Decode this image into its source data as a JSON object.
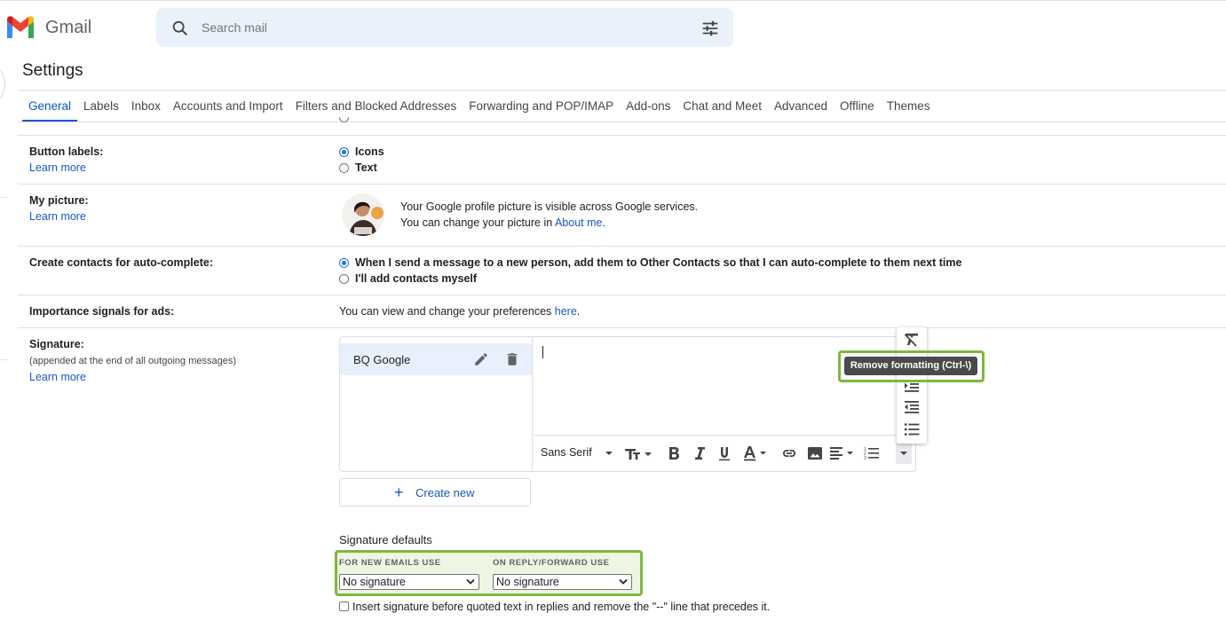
{
  "app": {
    "name": "Gmail"
  },
  "search": {
    "placeholder": "Search mail"
  },
  "settings": {
    "title": "Settings"
  },
  "tabs": [
    {
      "label": "General",
      "active": true
    },
    {
      "label": "Labels"
    },
    {
      "label": "Inbox"
    },
    {
      "label": "Accounts and Import"
    },
    {
      "label": "Filters and Blocked Addresses"
    },
    {
      "label": "Forwarding and POP/IMAP"
    },
    {
      "label": "Add-ons"
    },
    {
      "label": "Chat and Meet"
    },
    {
      "label": "Advanced"
    },
    {
      "label": "Offline"
    },
    {
      "label": "Themes"
    }
  ],
  "button_labels": {
    "label": "Button labels:",
    "learn_more": "Learn more",
    "options": [
      "Icons",
      "Text"
    ],
    "selected": "Icons"
  },
  "my_picture": {
    "label": "My picture:",
    "learn_more": "Learn more",
    "line1": "Your Google profile picture is visible across Google services.",
    "line2_prefix": "You can change your picture in ",
    "line2_link": "About me",
    "line2_suffix": "."
  },
  "contacts": {
    "label": "Create contacts for auto-complete:",
    "options": [
      "When I send a message to a new person, add them to Other Contacts so that I can auto-complete to them next time",
      "I'll add contacts myself"
    ],
    "selected": 0
  },
  "importance": {
    "label": "Importance signals for ads:",
    "text_prefix": "You can view and change your preferences ",
    "link": "here",
    "text_suffix": "."
  },
  "signature": {
    "label": "Signature:",
    "sub": "(appended at the end of all outgoing messages)",
    "learn_more": "Learn more",
    "items": [
      {
        "name": "BQ Google"
      }
    ],
    "font": "Sans Serif",
    "create_label": "Create new",
    "tooltip": "Remove formatting (Ctrl-\\)"
  },
  "signature_defaults": {
    "title": "Signature defaults",
    "new_caption": "FOR NEW EMAILS USE",
    "new_value": "No signature",
    "reply_caption": "ON REPLY/FORWARD USE",
    "reply_value": "No signature",
    "checkbox_label": "Insert signature before quoted text in replies and remove the \"--\" line that precedes it."
  },
  "colors": {
    "accent": "#0b57d0",
    "link": "#1a56c8",
    "highlight": "#7cb83c",
    "selected_row": "#e8f0fe"
  },
  "icons": [
    "gmail-logo",
    "search-icon",
    "tune-icon",
    "edit-icon",
    "delete-icon",
    "remove-formatting-icon",
    "indent-icon",
    "outdent-icon",
    "bulleted-list-icon"
  ]
}
